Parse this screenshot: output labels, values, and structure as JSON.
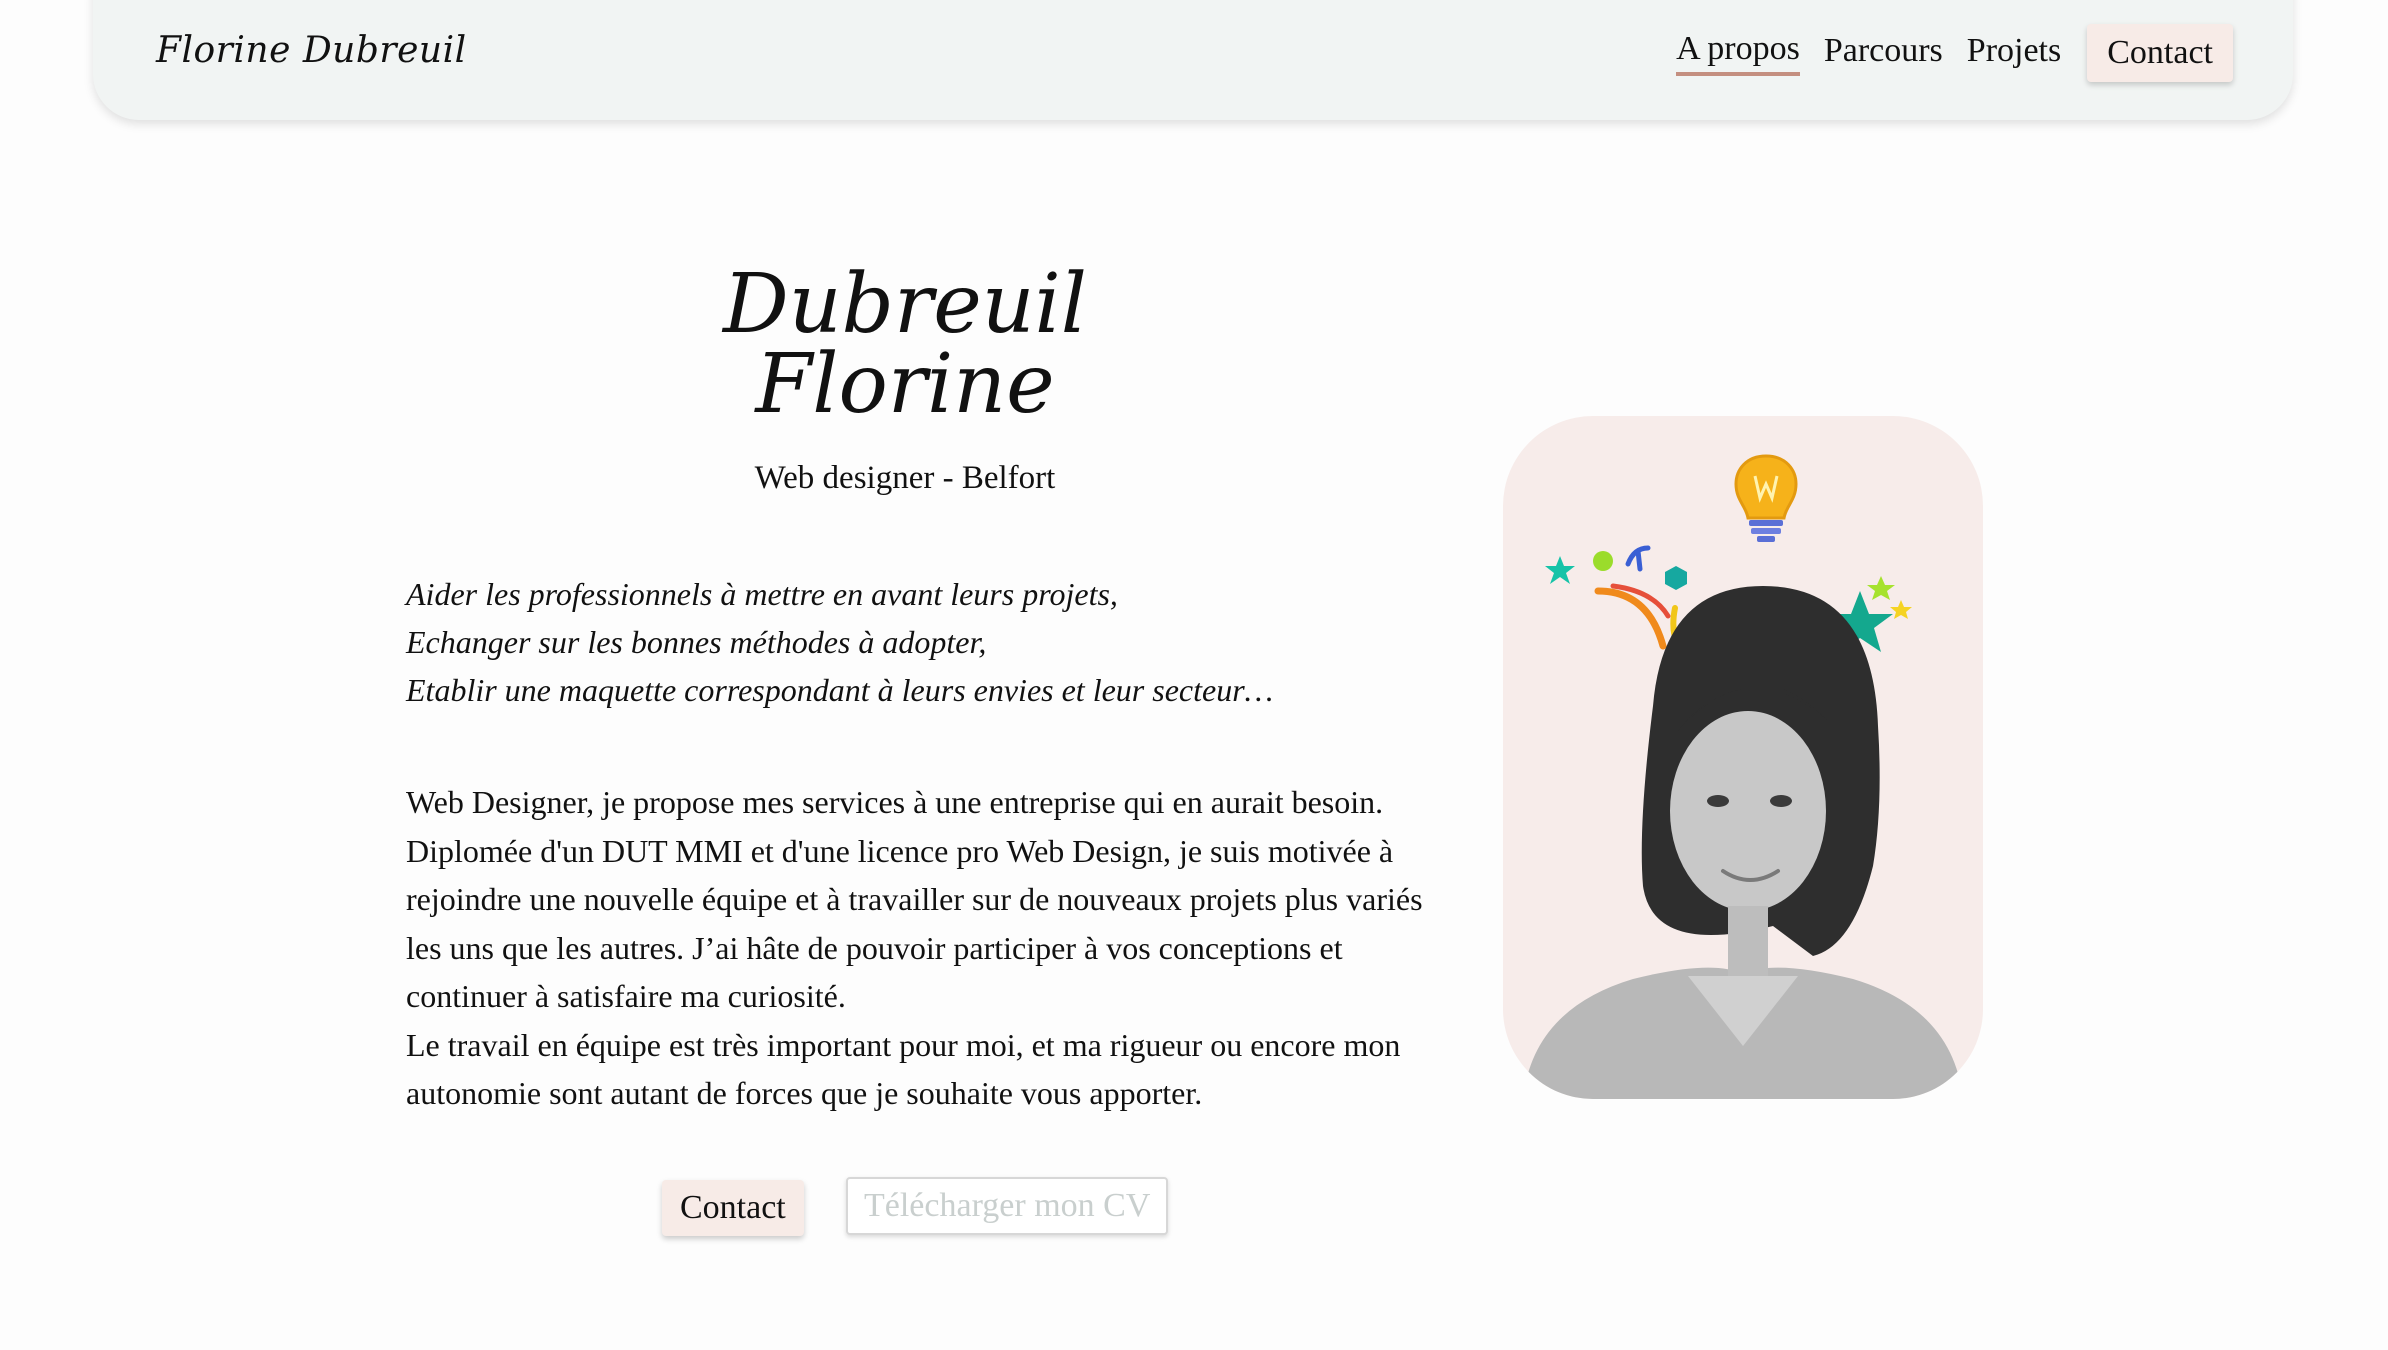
{
  "header": {
    "logo": "Florine Dubreuil",
    "nav": [
      {
        "label": "A propos",
        "active": true
      },
      {
        "label": "Parcours",
        "active": false
      },
      {
        "label": "Projets",
        "active": false
      }
    ],
    "contact_label": "Contact"
  },
  "hero": {
    "name_line1": "Dubreuil",
    "name_line2": "Florine",
    "subtitle": "Web designer - Belfort",
    "mission": [
      "Aider les professionnels à mettre en avant leurs projets,",
      "Echanger sur les bonnes méthodes à adopter,",
      "Etablir une maquette correspondant à leurs envies et leur secteur…"
    ],
    "bio_para1": "Web Designer, je propose mes services à une entreprise qui en aurait besoin. Diplomée d'un DUT MMI et d'une licence pro Web Design, je suis motivée à rejoindre une nouvelle équipe et à travailler sur de nouveaux projets plus variés les uns que les autres. J’ai hâte de pouvoir participer à vos conceptions et continuer à satisfaire ma curiosité.",
    "bio_para2": "Le travail en équipe est très important pour moi, et ma rigueur ou encore mon autonomie sont autant de forces que je souhaite vous apporter.",
    "contact_button": "Contact",
    "cv_button": "Télécharger mon CV"
  },
  "photo": {
    "icons": [
      "lightbulb-icon",
      "confetti-icon",
      "star-icon"
    ],
    "colors": {
      "card_bg": "#f7ecea",
      "accent": "#c48f80",
      "button_bg": "#f7ebe7"
    }
  }
}
